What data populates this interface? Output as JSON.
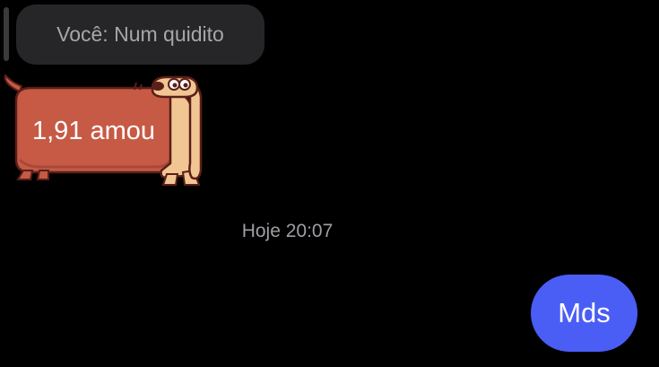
{
  "reply": {
    "quoted_text": "Você: Num quidito"
  },
  "sticker_message": {
    "text": "1,91 amou",
    "icon": "dachshund-dog-sticker",
    "color": "#c65a45"
  },
  "timestamp": "Hoje 20:07",
  "sent_message": {
    "text": "Mds",
    "color": "#4a5df5"
  }
}
